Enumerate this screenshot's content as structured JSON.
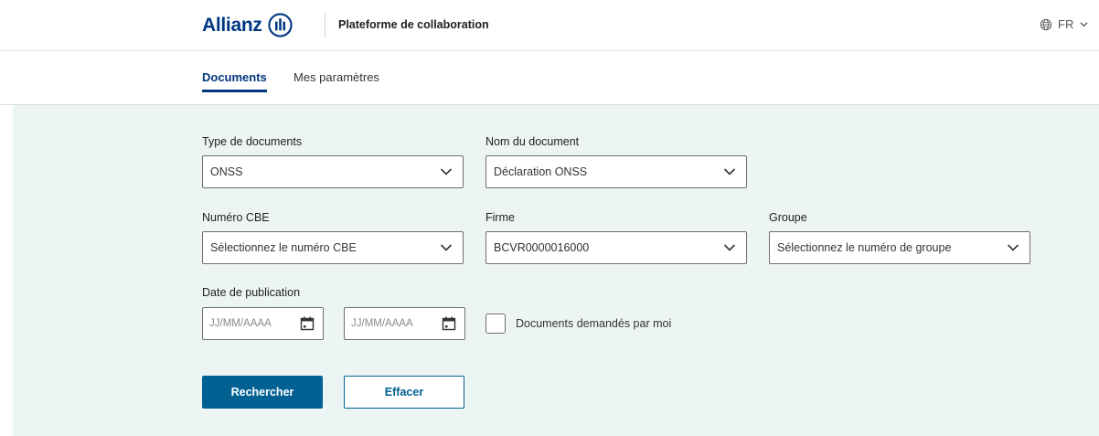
{
  "header": {
    "brand": "Allianz",
    "platform_title": "Plateforme de collaboration",
    "language": "FR",
    "icons": [
      "allianz-logo",
      "globe-icon",
      "chevron-down-icon"
    ]
  },
  "tabs": [
    {
      "label": "Documents",
      "active": true
    },
    {
      "label": "Mes paramètres",
      "active": false
    }
  ],
  "filters": {
    "doc_type": {
      "label": "Type de documents",
      "value": "ONSS"
    },
    "doc_name": {
      "label": "Nom du document",
      "value": "Déclaration ONSS"
    },
    "cbe": {
      "label": "Numéro CBE",
      "value": "Sélectionnez le numéro CBE"
    },
    "firm": {
      "label": "Firme",
      "value": "BCVR0000016000"
    },
    "group": {
      "label": "Groupe",
      "value": "Sélectionnez le numéro de groupe"
    },
    "pub_date": {
      "label": "Date de publication",
      "from_placeholder": "JJ/MM/AAAA",
      "to_placeholder": "JJ/MM/AAAA"
    },
    "requested_by_me": {
      "label": "Documents demandés par moi",
      "checked": false
    }
  },
  "actions": {
    "search": "Rechercher",
    "clear": "Effacer"
  },
  "colors": {
    "brand_blue": "#003781",
    "button_blue": "#006192",
    "panel_bg": "#edf5f4"
  }
}
